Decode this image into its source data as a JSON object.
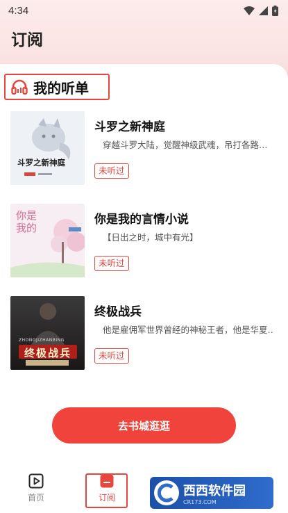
{
  "status_bar": {
    "time": "4:34"
  },
  "header": {
    "title": "订阅"
  },
  "section": {
    "title": "我的听单"
  },
  "books": [
    {
      "title": "斗罗之新神庭",
      "description": "穿越斗罗大陆，觉醒神级武魂，吊打各路…",
      "status": "未听过",
      "cover_text": "斗罗之新神庭"
    },
    {
      "title": "你是我的言情小说",
      "description": "【日出之时，城中有光】",
      "status": "未听过",
      "cover_text": "你是我的"
    },
    {
      "title": "终极战兵",
      "description": "他是雇佣军世界曾经的神秘王者，他是华夏…",
      "status": "未听过",
      "cover_text": "终极战兵",
      "cover_pinyin": "ZHONGJIZHANBING"
    }
  ],
  "cta": {
    "label": "去书城逛逛"
  },
  "nav": [
    {
      "label": "首页",
      "icon": "play-square-icon"
    },
    {
      "label": "订阅",
      "icon": "subscribe-icon"
    }
  ],
  "watermark": {
    "text": "西西软件园",
    "sub": "CR173.COM"
  },
  "colors": {
    "accent": "#e8453c",
    "cta": "#f0433b",
    "bg_top": "#fdecec"
  }
}
